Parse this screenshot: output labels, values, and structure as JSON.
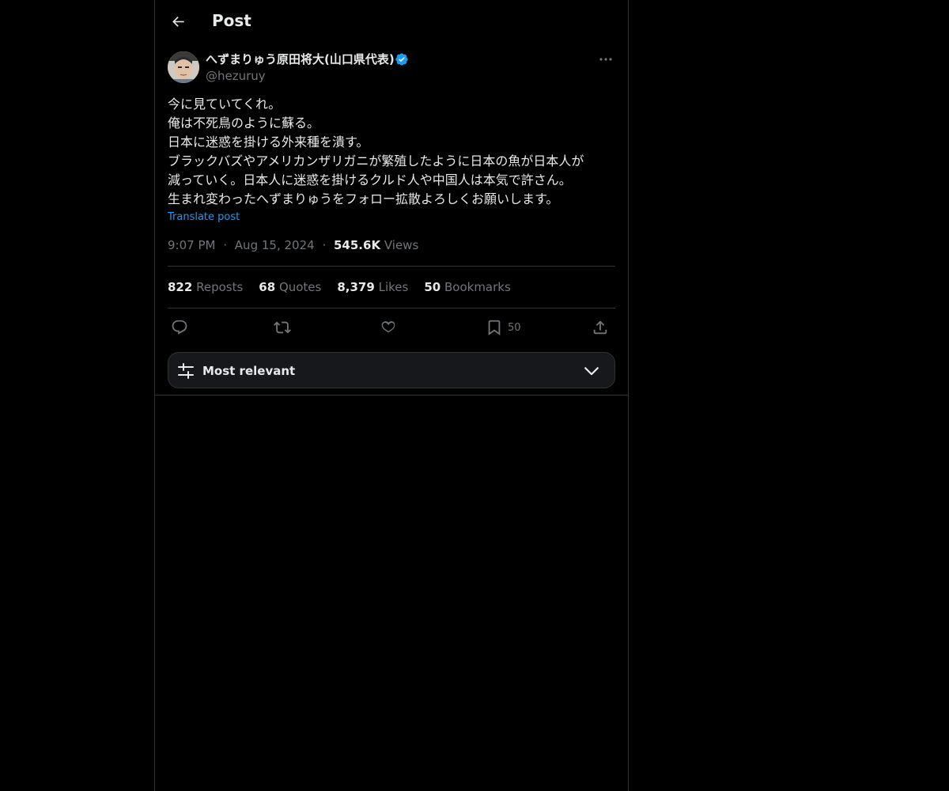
{
  "header": {
    "title": "Post"
  },
  "author": {
    "display_name": "へずまりゅう原田将大(山口県代表)",
    "handle": "@hezuruy",
    "verified": true
  },
  "post": {
    "lines": [
      "今に見ていてくれ。",
      "俺は不死鳥のように蘇る。",
      "日本に迷惑を掛ける外来種を潰す。",
      "ブラックバズやアメリカンザリガニが繁殖したように日本の魚が日本人が",
      "減っていく。日本人に迷惑を掛けるクルド人や中国人は本気で許さん。",
      "生まれ変わったへずまりゅうをフォロー拡散よろしくお願いします。"
    ],
    "translate_label": "Translate post",
    "time": "9:07 PM",
    "date": "Aug 15, 2024",
    "separator": "·",
    "views_count": "545.6K",
    "views_label": "Views"
  },
  "stats": {
    "reposts_count": "822",
    "reposts_label": "Reposts",
    "quotes_count": "68",
    "quotes_label": "Quotes",
    "likes_count": "8,379",
    "likes_label": "Likes",
    "bookmarks_count": "50",
    "bookmarks_label": "Bookmarks"
  },
  "actions": {
    "bookmark_count": "50"
  },
  "sort": {
    "label": "Most relevant"
  },
  "colors": {
    "background": "#000000",
    "text": "#e7e9ea",
    "muted": "#71767b",
    "accent": "#1d9bf0",
    "border": "#2f3336",
    "sort_bar_bg": "#16181c"
  },
  "icons": [
    "arrow-left-icon",
    "verified-badge-icon",
    "more-dots-icon",
    "reply-icon",
    "repost-icon",
    "like-icon",
    "bookmark-icon",
    "share-icon",
    "sliders-icon",
    "chevron-down-icon"
  ]
}
